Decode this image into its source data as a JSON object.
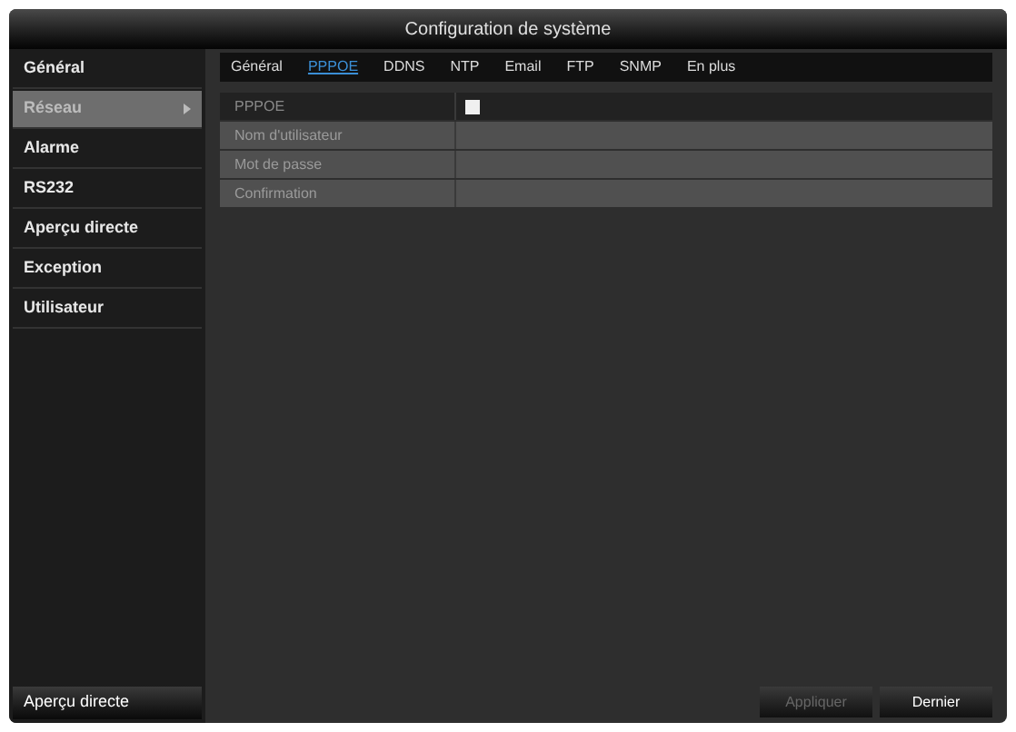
{
  "window": {
    "title": "Configuration de système"
  },
  "sidebar": {
    "items": [
      {
        "label": "Général",
        "selected": false,
        "has_arrow": false
      },
      {
        "label": "Réseau",
        "selected": true,
        "has_arrow": true
      },
      {
        "label": "Alarme",
        "selected": false,
        "has_arrow": false
      },
      {
        "label": "RS232",
        "selected": false,
        "has_arrow": false
      },
      {
        "label": "Aperçu directe",
        "selected": false,
        "has_arrow": false
      },
      {
        "label": "Exception",
        "selected": false,
        "has_arrow": false
      },
      {
        "label": "Utilisateur",
        "selected": false,
        "has_arrow": false
      }
    ],
    "footer_button": "Aperçu directe"
  },
  "tabs": [
    {
      "label": "Général",
      "selected": false
    },
    {
      "label": "PPPOE",
      "selected": true
    },
    {
      "label": "DDNS",
      "selected": false
    },
    {
      "label": "NTP",
      "selected": false
    },
    {
      "label": "Email",
      "selected": false
    },
    {
      "label": "FTP",
      "selected": false
    },
    {
      "label": "SNMP",
      "selected": false
    },
    {
      "label": "En plus",
      "selected": false
    }
  ],
  "form": [
    {
      "kind": "checkbox",
      "label": "PPPOE",
      "checked": false,
      "disabled": false
    },
    {
      "kind": "text",
      "label": "Nom d'utilisateur",
      "disabled": true
    },
    {
      "kind": "text",
      "label": "Mot de passe",
      "disabled": true
    },
    {
      "kind": "text",
      "label": "Confirmation",
      "disabled": true
    }
  ],
  "buttons": [
    {
      "label": "Appliquer",
      "disabled": true
    },
    {
      "label": "Dernier",
      "disabled": false
    }
  ]
}
